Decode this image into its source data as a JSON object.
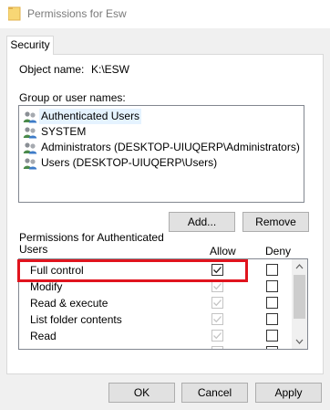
{
  "window": {
    "title": "Permissions for Esw"
  },
  "tabs": [
    {
      "label": "Security"
    }
  ],
  "object": {
    "label": "Object name:",
    "value": "K:\\ESW"
  },
  "groups": {
    "label": "Group or user names:",
    "items": [
      {
        "label": "Authenticated Users",
        "icon": "users-icon",
        "selected": true
      },
      {
        "label": "SYSTEM",
        "icon": "users-icon",
        "selected": false
      },
      {
        "label": "Administrators (DESKTOP-UIUQERP\\Administrators)",
        "icon": "users-icon",
        "selected": false
      },
      {
        "label": "Users (DESKTOP-UIUQERP\\Users)",
        "icon": "users-icon",
        "selected": false
      }
    ]
  },
  "buttons": {
    "add": "Add...",
    "remove": "Remove",
    "ok": "OK",
    "cancel": "Cancel",
    "apply": "Apply"
  },
  "permissions": {
    "header": "Permissions for Authenticated Users",
    "allow_label": "Allow",
    "deny_label": "Deny",
    "rows": [
      {
        "name": "Full control",
        "allow": true,
        "allow_enabled": true,
        "deny": false
      },
      {
        "name": "Modify",
        "allow": true,
        "allow_enabled": false,
        "deny": false
      },
      {
        "name": "Read & execute",
        "allow": true,
        "allow_enabled": false,
        "deny": false
      },
      {
        "name": "List folder contents",
        "allow": true,
        "allow_enabled": false,
        "deny": false
      },
      {
        "name": "Read",
        "allow": true,
        "allow_enabled": false,
        "deny": false
      },
      {
        "name": "",
        "allow": true,
        "allow_enabled": false,
        "deny": false
      }
    ]
  },
  "colors": {
    "highlight": "#e0141e",
    "selection": "#e5f3ff",
    "window_bg": "#f0f0f0"
  }
}
